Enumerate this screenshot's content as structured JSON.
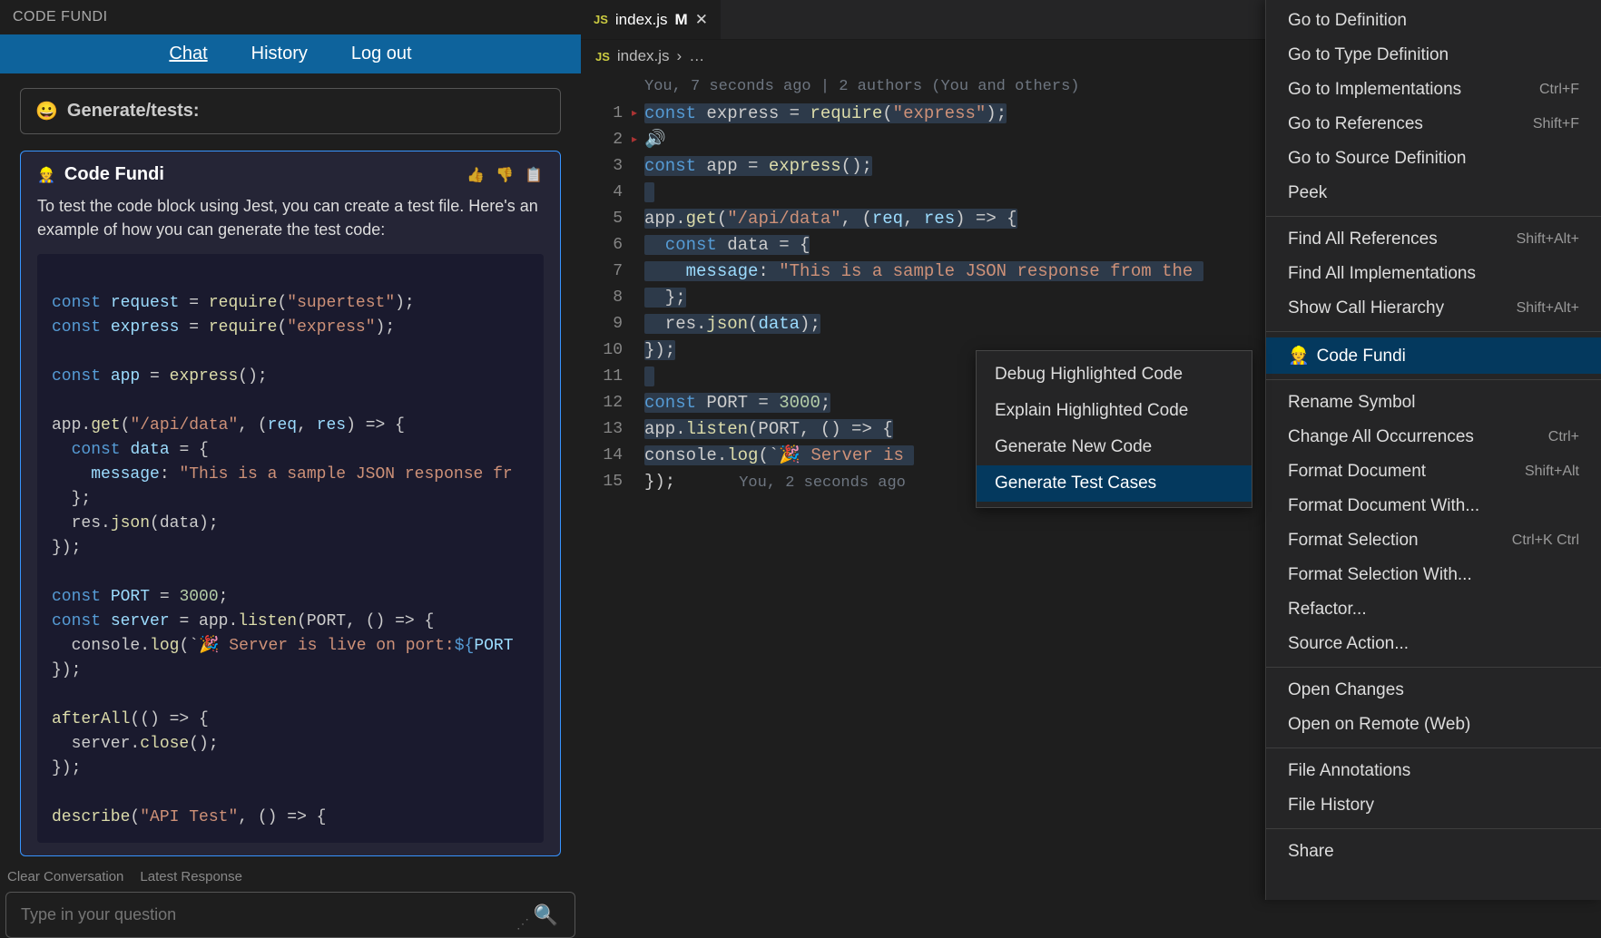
{
  "sidebar": {
    "title": "CODE FUNDI",
    "tabs": {
      "chat": "Chat",
      "history": "History",
      "logout": "Log out"
    },
    "prompt_emoji": "😀",
    "prompt_text": "Generate/tests:",
    "response": {
      "name_emoji": "👷",
      "name": "Code Fundi",
      "intro": "To test the code block using Jest, you can create a test file. Here's an example of how you can generate the test code:"
    },
    "code_example": {
      "l1_a": "const",
      "l1_b": "request",
      "l1_c": " = ",
      "l1_d": "require",
      "l1_e": "(",
      "l1_f": "\"supertest\"",
      "l1_g": ");",
      "l2_a": "const",
      "l2_b": "express",
      "l2_c": " = ",
      "l2_d": "require",
      "l2_e": "(",
      "l2_f": "\"express\"",
      "l2_g": ");",
      "l4_a": "const",
      "l4_b": "app",
      "l4_c": " = ",
      "l4_d": "express",
      "l4_e": "();",
      "l6_a": "app.",
      "l6_b": "get",
      "l6_c": "(",
      "l6_d": "\"/api/data\"",
      "l6_e": ", (",
      "l6_f": "req",
      "l6_g": ", ",
      "l6_h": "res",
      "l6_i": ") => {",
      "l7_a": "  const",
      "l7_b": "data",
      "l7_c": " = {",
      "l8_a": "    message",
      "l8_b": ": ",
      "l8_c": "\"This is a sample JSON response fr",
      "l9": "  };",
      "l10_a": "  res.",
      "l10_b": "json",
      "l10_c": "(data);",
      "l11": "});",
      "l13_a": "const",
      "l13_b": "PORT",
      "l13_c": " = ",
      "l13_d": "3000",
      "l13_e": ";",
      "l14_a": "const",
      "l14_b": "server",
      "l14_c": " = app.",
      "l14_d": "listen",
      "l14_e": "(PORT, () => {",
      "l15_a": "  console.",
      "l15_b": "log",
      "l15_c": "(`",
      "l15_d": "🎉",
      "l15_e": " Server is live on port:",
      "l15_f": "${",
      "l15_g": "PORT",
      "l16": "});",
      "l18_a": "afterAll",
      "l18_b": "(() => {",
      "l19_a": "  server.",
      "l19_b": "close",
      "l19_c": "();",
      "l20": "});",
      "l22_a": "describe",
      "l22_b": "(",
      "l22_c": "\"API Test\"",
      "l22_d": ", () => {"
    },
    "bottom_links": {
      "clear": "Clear Conversation",
      "latest": "Latest Response"
    },
    "input_placeholder": "Type in your question"
  },
  "editor": {
    "tab": {
      "name": "index.js",
      "modified_marker": "M"
    },
    "breadcrumb": {
      "file": "index.js",
      "sep": "›",
      "dots": "…"
    },
    "blame_top": "You, 7 seconds ago | 2 authors (You and others)",
    "lines": {
      "n": [
        "1",
        "2",
        "3",
        "4",
        "5",
        "6",
        "7",
        "8",
        "9",
        "10",
        "11",
        "12",
        "13",
        "14",
        "15"
      ],
      "l1_a": "const",
      "l1_b": " express = ",
      "l1_c": "require",
      "l1_d": "(",
      "l1_e": "\"express\"",
      "l1_f": ");",
      "l2": "🔊",
      "l3_a": "const",
      "l3_b": " app = ",
      "l3_c": "express",
      "l3_d": "();",
      "l5_a": "app.",
      "l5_b": "get",
      "l5_c": "(",
      "l5_d": "\"/api/data\"",
      "l5_e": ", (",
      "l5_f": "req",
      "l5_g": ", ",
      "l5_h": "res",
      "l5_i": ") => {",
      "l6_a": "  const",
      "l6_b": " data = {",
      "l7_a": "    message",
      "l7_b": ": ",
      "l7_c": "\"This is a sample JSON response from the ",
      "l8": "  };",
      "l9_a": "  res.",
      "l9_b": "json",
      "l9_c": "(",
      "l9_d": "data",
      "l9_e": ");",
      "l10": "});",
      "l12_a": "const",
      "l12_b": " PORT = ",
      "l12_c": "3000",
      "l12_d": ";",
      "l13_a": "app.",
      "l13_b": "listen",
      "l13_c": "(PORT, () => {",
      "l14_a": "console.",
      "l14_b": "log",
      "l14_c": "(`",
      "l14_d": "🎉",
      "l14_e": " Server is ",
      "l15": "});",
      "inline_blame": "You, 2 seconds ago"
    }
  },
  "submenu": {
    "debug": "Debug Highlighted Code",
    "explain": "Explain Highlighted Code",
    "generate": "Generate New Code",
    "tests": "Generate Test Cases"
  },
  "ctx": {
    "items": [
      {
        "label": "Go to Definition",
        "kbd": ""
      },
      {
        "label": "Go to Type Definition",
        "kbd": ""
      },
      {
        "label": "Go to Implementations",
        "kbd": "Ctrl+F"
      },
      {
        "label": "Go to References",
        "kbd": "Shift+F"
      },
      {
        "label": "Go to Source Definition",
        "kbd": ""
      },
      {
        "label": "Peek",
        "kbd": ""
      },
      {
        "sep": true
      },
      {
        "label": "Find All References",
        "kbd": "Shift+Alt+"
      },
      {
        "label": "Find All Implementations",
        "kbd": ""
      },
      {
        "label": "Show Call Hierarchy",
        "kbd": "Shift+Alt+"
      },
      {
        "sep": true
      },
      {
        "label": "Code Fundi",
        "kbd": "",
        "emoji": "👷",
        "active": true
      },
      {
        "sep": true
      },
      {
        "label": "Rename Symbol",
        "kbd": ""
      },
      {
        "label": "Change All Occurrences",
        "kbd": "Ctrl+"
      },
      {
        "label": "Format Document",
        "kbd": "Shift+Alt"
      },
      {
        "label": "Format Document With...",
        "kbd": ""
      },
      {
        "label": "Format Selection",
        "kbd": "Ctrl+K Ctrl"
      },
      {
        "label": "Format Selection With...",
        "kbd": ""
      },
      {
        "label": "Refactor...",
        "kbd": ""
      },
      {
        "label": "Source Action...",
        "kbd": ""
      },
      {
        "sep": true
      },
      {
        "label": "Open Changes",
        "kbd": ""
      },
      {
        "label": "Open on Remote (Web)",
        "kbd": ""
      },
      {
        "sep": true
      },
      {
        "label": "File Annotations",
        "kbd": ""
      },
      {
        "label": "File History",
        "kbd": ""
      },
      {
        "sep": true
      },
      {
        "label": "Share",
        "kbd": ""
      }
    ]
  }
}
